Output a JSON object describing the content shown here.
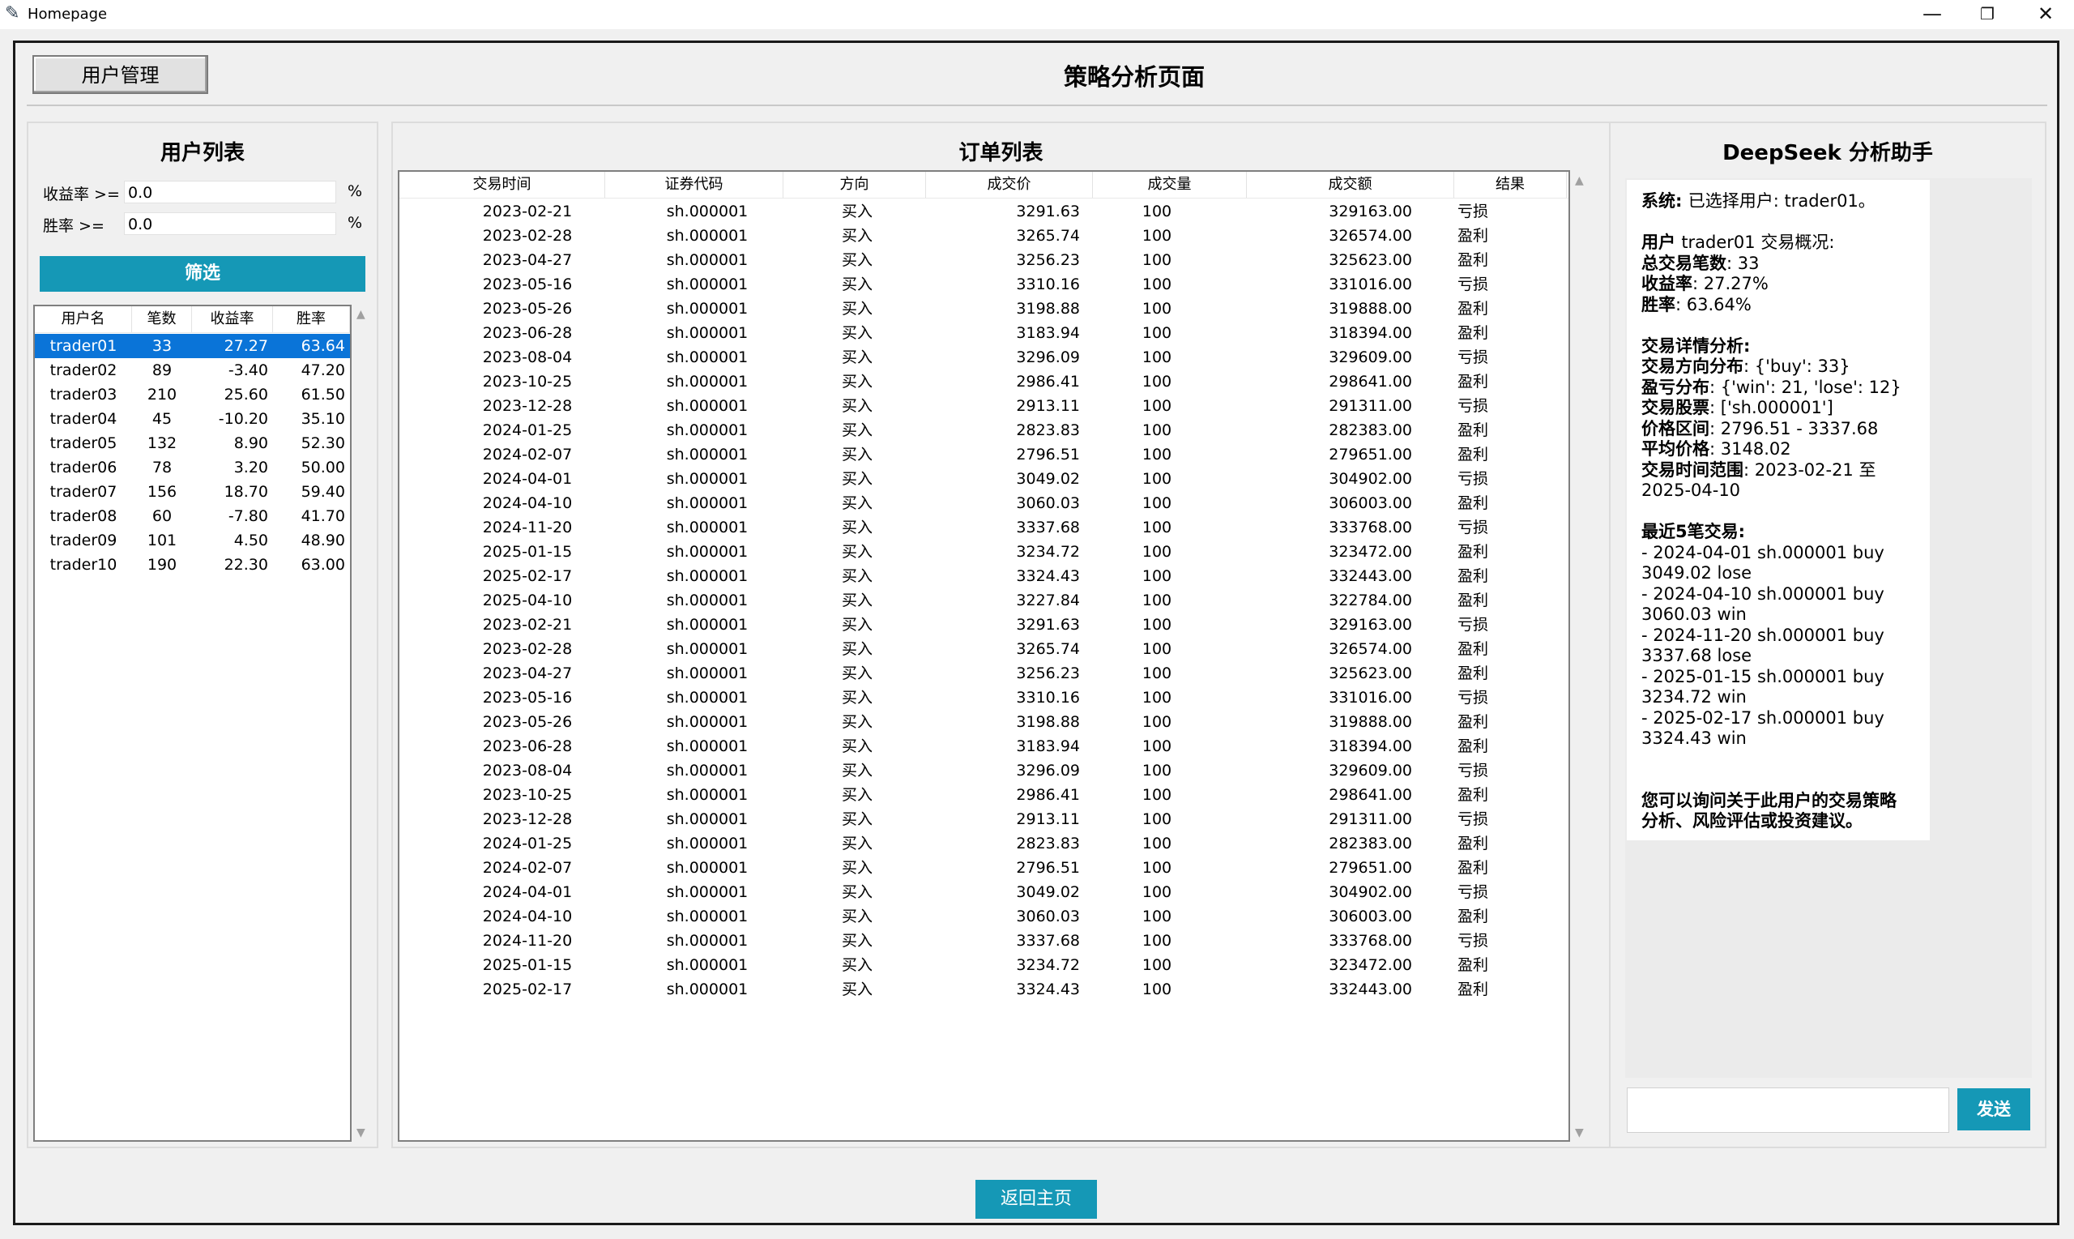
{
  "window": {
    "title": "Homepage"
  },
  "header": {
    "user_mgmt_label": "用户管理",
    "page_title": "策略分析页面"
  },
  "user_panel": {
    "title": "用户列表",
    "return_label": "收益率 >=",
    "return_value": "0.0",
    "winrate_label": "胜率 >=",
    "winrate_value": "0.0",
    "pct": "%",
    "filter_label": "筛选",
    "columns": [
      "用户名",
      "笔数",
      "收益率",
      "胜率"
    ],
    "selected_index": 0,
    "users": [
      [
        "trader01",
        "33",
        "27.27",
        "63.64"
      ],
      [
        "trader02",
        "89",
        "-3.40",
        "47.20"
      ],
      [
        "trader03",
        "210",
        "25.60",
        "61.50"
      ],
      [
        "trader04",
        "45",
        "-10.20",
        "35.10"
      ],
      [
        "trader05",
        "132",
        "8.90",
        "52.30"
      ],
      [
        "trader06",
        "78",
        "3.20",
        "50.00"
      ],
      [
        "trader07",
        "156",
        "18.70",
        "59.40"
      ],
      [
        "trader08",
        "60",
        "-7.80",
        "41.70"
      ],
      [
        "trader09",
        "101",
        "4.50",
        "48.90"
      ],
      [
        "trader10",
        "190",
        "22.30",
        "63.00"
      ]
    ]
  },
  "order_panel": {
    "title": "订单列表",
    "columns": [
      "交易时间",
      "证券代码",
      "方向",
      "成交价",
      "成交量",
      "成交额",
      "结果"
    ],
    "orders": [
      [
        "2023-02-21",
        "sh.000001",
        "买入",
        "3291.63",
        "100",
        "329163.00",
        "亏损"
      ],
      [
        "2023-02-28",
        "sh.000001",
        "买入",
        "3265.74",
        "100",
        "326574.00",
        "盈利"
      ],
      [
        "2023-04-27",
        "sh.000001",
        "买入",
        "3256.23",
        "100",
        "325623.00",
        "盈利"
      ],
      [
        "2023-05-16",
        "sh.000001",
        "买入",
        "3310.16",
        "100",
        "331016.00",
        "亏损"
      ],
      [
        "2023-05-26",
        "sh.000001",
        "买入",
        "3198.88",
        "100",
        "319888.00",
        "盈利"
      ],
      [
        "2023-06-28",
        "sh.000001",
        "买入",
        "3183.94",
        "100",
        "318394.00",
        "盈利"
      ],
      [
        "2023-08-04",
        "sh.000001",
        "买入",
        "3296.09",
        "100",
        "329609.00",
        "亏损"
      ],
      [
        "2023-10-25",
        "sh.000001",
        "买入",
        "2986.41",
        "100",
        "298641.00",
        "盈利"
      ],
      [
        "2023-12-28",
        "sh.000001",
        "买入",
        "2913.11",
        "100",
        "291311.00",
        "亏损"
      ],
      [
        "2024-01-25",
        "sh.000001",
        "买入",
        "2823.83",
        "100",
        "282383.00",
        "盈利"
      ],
      [
        "2024-02-07",
        "sh.000001",
        "买入",
        "2796.51",
        "100",
        "279651.00",
        "盈利"
      ],
      [
        "2024-04-01",
        "sh.000001",
        "买入",
        "3049.02",
        "100",
        "304902.00",
        "亏损"
      ],
      [
        "2024-04-10",
        "sh.000001",
        "买入",
        "3060.03",
        "100",
        "306003.00",
        "盈利"
      ],
      [
        "2024-11-20",
        "sh.000001",
        "买入",
        "3337.68",
        "100",
        "333768.00",
        "亏损"
      ],
      [
        "2025-01-15",
        "sh.000001",
        "买入",
        "3234.72",
        "100",
        "323472.00",
        "盈利"
      ],
      [
        "2025-02-17",
        "sh.000001",
        "买入",
        "3324.43",
        "100",
        "332443.00",
        "盈利"
      ],
      [
        "2025-04-10",
        "sh.000001",
        "买入",
        "3227.84",
        "100",
        "322784.00",
        "盈利"
      ],
      [
        "2023-02-21",
        "sh.000001",
        "买入",
        "3291.63",
        "100",
        "329163.00",
        "亏损"
      ],
      [
        "2023-02-28",
        "sh.000001",
        "买入",
        "3265.74",
        "100",
        "326574.00",
        "盈利"
      ],
      [
        "2023-04-27",
        "sh.000001",
        "买入",
        "3256.23",
        "100",
        "325623.00",
        "盈利"
      ],
      [
        "2023-05-16",
        "sh.000001",
        "买入",
        "3310.16",
        "100",
        "331016.00",
        "亏损"
      ],
      [
        "2023-05-26",
        "sh.000001",
        "买入",
        "3198.88",
        "100",
        "319888.00",
        "盈利"
      ],
      [
        "2023-06-28",
        "sh.000001",
        "买入",
        "3183.94",
        "100",
        "318394.00",
        "盈利"
      ],
      [
        "2023-08-04",
        "sh.000001",
        "买入",
        "3296.09",
        "100",
        "329609.00",
        "亏损"
      ],
      [
        "2023-10-25",
        "sh.000001",
        "买入",
        "2986.41",
        "100",
        "298641.00",
        "盈利"
      ],
      [
        "2023-12-28",
        "sh.000001",
        "买入",
        "2913.11",
        "100",
        "291311.00",
        "亏损"
      ],
      [
        "2024-01-25",
        "sh.000001",
        "买入",
        "2823.83",
        "100",
        "282383.00",
        "盈利"
      ],
      [
        "2024-02-07",
        "sh.000001",
        "买入",
        "2796.51",
        "100",
        "279651.00",
        "盈利"
      ],
      [
        "2024-04-01",
        "sh.000001",
        "买入",
        "3049.02",
        "100",
        "304902.00",
        "亏损"
      ],
      [
        "2024-04-10",
        "sh.000001",
        "买入",
        "3060.03",
        "100",
        "306003.00",
        "盈利"
      ],
      [
        "2024-11-20",
        "sh.000001",
        "买入",
        "3337.68",
        "100",
        "333768.00",
        "亏损"
      ],
      [
        "2025-01-15",
        "sh.000001",
        "买入",
        "3234.72",
        "100",
        "323472.00",
        "盈利"
      ],
      [
        "2025-02-17",
        "sh.000001",
        "买入",
        "3324.43",
        "100",
        "332443.00",
        "盈利"
      ]
    ]
  },
  "assistant_panel": {
    "title": "DeepSeek 分析助手",
    "send_label": "发送",
    "lines": [
      {
        "bold": "系统: ",
        "text": "已选择用户: trader01。"
      },
      {
        "bold": "",
        "text": ""
      },
      {
        "bold": "用户 ",
        "text": "trader01 交易概况:"
      },
      {
        "bold": "总交易笔数",
        "text": ": 33"
      },
      {
        "bold": "收益率",
        "text": ": 27.27%"
      },
      {
        "bold": "胜率",
        "text": ": 63.64%"
      },
      {
        "bold": "",
        "text": ""
      },
      {
        "bold": "交易详情分析:",
        "text": ""
      },
      {
        "bold": "交易方向分布",
        "text": ": {'buy': 33}"
      },
      {
        "bold": "盈亏分布",
        "text": ": {'win': 21, 'lose': 12}"
      },
      {
        "bold": "交易股票",
        "text": ": ['sh.000001']"
      },
      {
        "bold": "价格区间",
        "text": ": 2796.51 - 3337.68"
      },
      {
        "bold": "平均价格",
        "text": ": 3148.02"
      },
      {
        "bold": "交易时间范围",
        "text": ": 2023-02-21 至"
      },
      {
        "bold": "",
        "text": "2025-04-10"
      },
      {
        "bold": "",
        "text": ""
      },
      {
        "bold": "最近5笔交易:",
        "text": ""
      },
      {
        "bold": "",
        "text": "- 2024-04-01 sh.000001 buy"
      },
      {
        "bold": "",
        "text": "3049.02 lose"
      },
      {
        "bold": "",
        "text": "- 2024-04-10 sh.000001 buy"
      },
      {
        "bold": "",
        "text": "3060.03 win"
      },
      {
        "bold": "",
        "text": "- 2024-11-20 sh.000001 buy"
      },
      {
        "bold": "",
        "text": "3337.68 lose"
      },
      {
        "bold": "",
        "text": "- 2025-01-15 sh.000001 buy"
      },
      {
        "bold": "",
        "text": "3234.72 win"
      },
      {
        "bold": "",
        "text": "- 2025-02-17 sh.000001 buy"
      },
      {
        "bold": "",
        "text": "3324.43 win"
      },
      {
        "bold": "",
        "text": ""
      },
      {
        "bold": "",
        "text": ""
      },
      {
        "bold": "您可以询问关于此用户的交易策略",
        "text": ""
      },
      {
        "bold": "分析、风险评估或投资建议。",
        "text": ""
      }
    ]
  },
  "footer": {
    "back_label": "返回主页"
  },
  "colors": {
    "accent": "#1598b6",
    "selection": "#0a74d8"
  }
}
